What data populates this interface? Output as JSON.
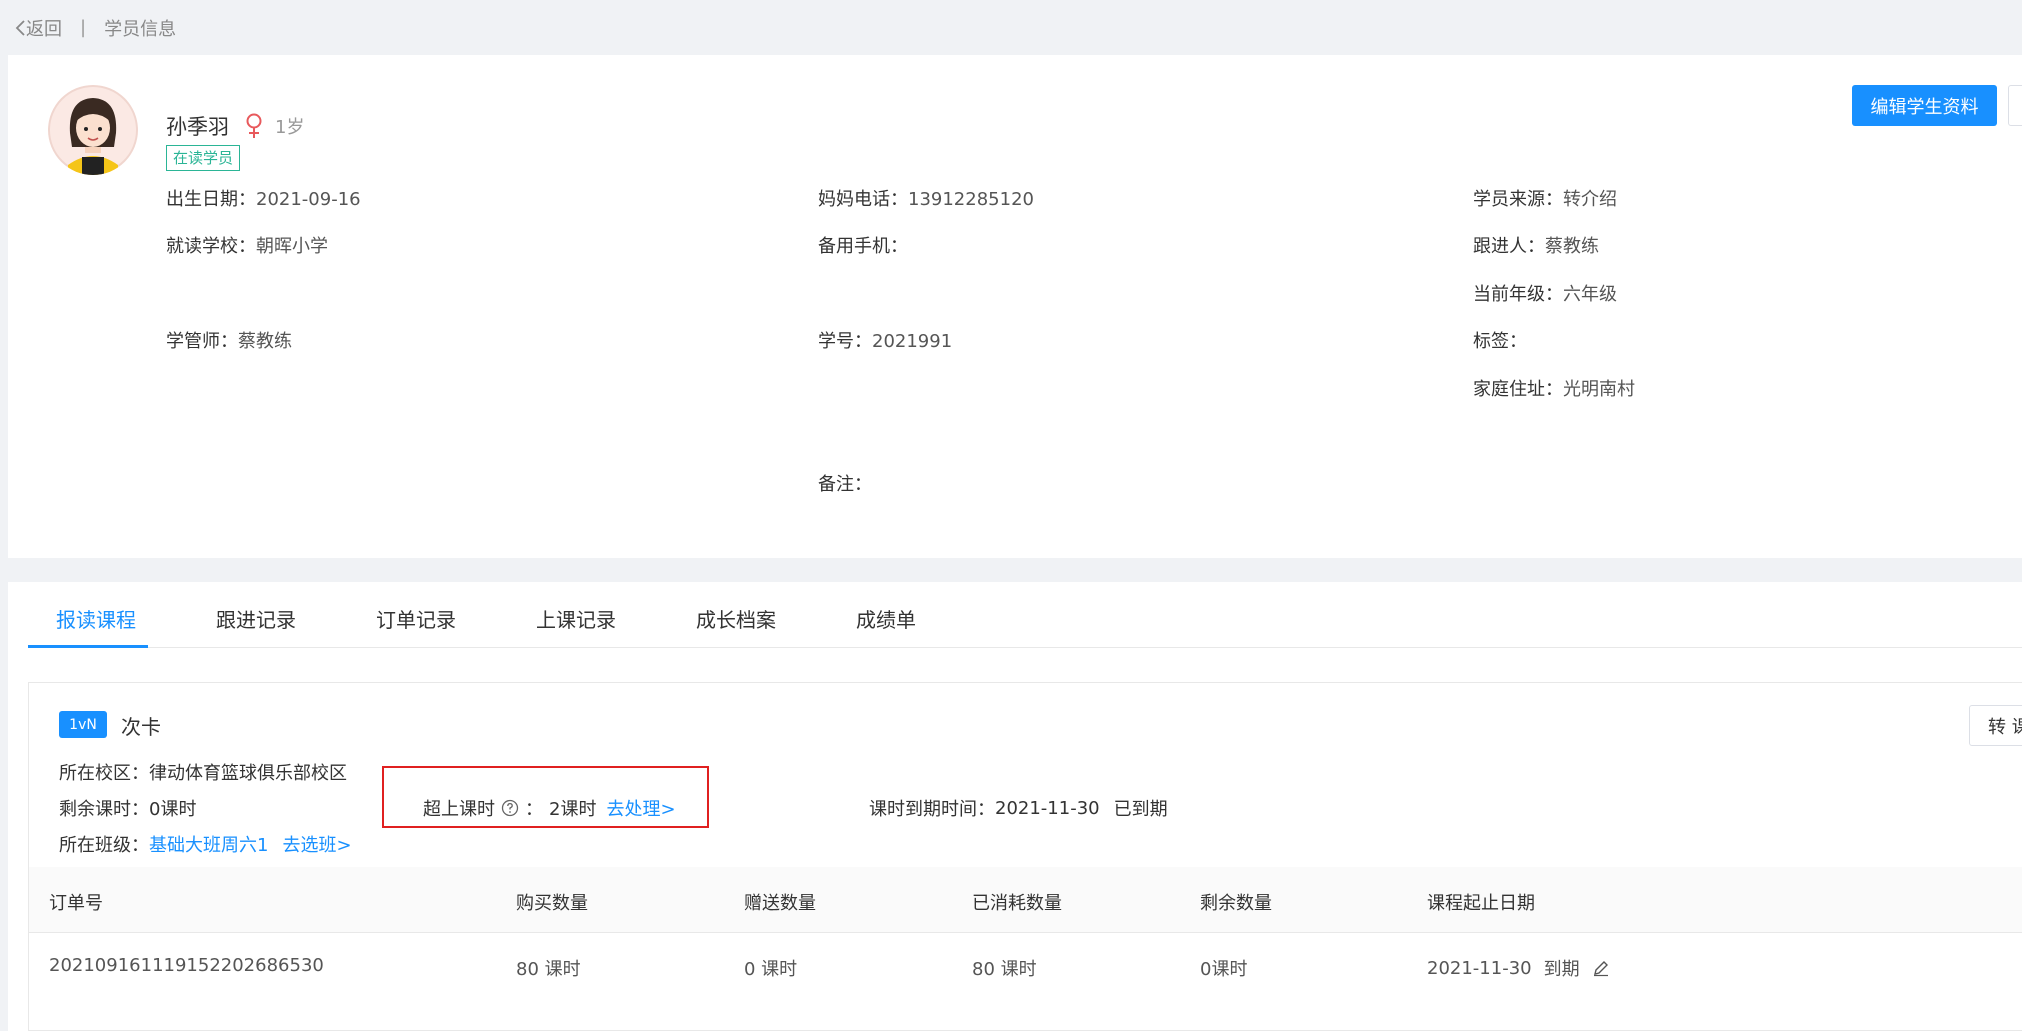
{
  "topbar": {
    "back_label": "返回",
    "separator": "|",
    "page_title": "学员信息"
  },
  "student": {
    "name": "孙季羽",
    "gender_symbol": "♀",
    "age": "1岁",
    "status": "在读学员",
    "edit_label": "编辑学生资料",
    "fields": {
      "birth_label": "出生日期：",
      "birth": "2021-09-16",
      "school_label": "就读学校：",
      "school": "朝晖小学",
      "manager_label": "学管师：",
      "manager": "蔡教练",
      "mom_phone_label": "妈妈电话：",
      "mom_phone": "13912285120",
      "backup_phone_label": "备用手机：",
      "backup_phone": "",
      "student_no_label": "学号：",
      "student_no": "2021991",
      "remark_label": "备注：",
      "remark": "",
      "source_label": "学员来源：",
      "source": "转介绍",
      "follower_label": "跟进人：",
      "follower": "蔡教练",
      "grade_label": "当前年级：",
      "grade": "六年级",
      "tag_label": "标签：",
      "tag": "",
      "address_label": "家庭住址：",
      "address": "光明南村"
    }
  },
  "tabs": [
    "报读课程",
    "跟进记录",
    "订单记录",
    "上课记录",
    "成长档案",
    "成绩单"
  ],
  "course": {
    "badge": "1vN",
    "type": "次卡",
    "campus_label": "所在校区：",
    "campus": "律动体育篮球俱乐部校区",
    "remaining_label": "剩余课时：",
    "remaining": "0课时",
    "class_label": "所在班级：",
    "class_name": "基础大班周六1",
    "select_class": "去选班>",
    "over_label": "超上课时",
    "over_sep": "：",
    "over_value": "2课时",
    "over_action": "去处理>",
    "expire_label": "课时到期时间：",
    "expire_date": "2021-11-30",
    "expire_status": "已到期",
    "transfer_label": "转 课"
  },
  "table": {
    "headers": [
      "订单号",
      "购买数量",
      "赠送数量",
      "已消耗数量",
      "剩余数量",
      "课程起止日期"
    ],
    "rows": [
      {
        "order_no": "20210916111915220268653​0",
        "purchased": "80 课时",
        "gifted": "0 课时",
        "consumed": "80 课时",
        "remaining": "0课时",
        "date": "2021-11-30",
        "date_status": "到期"
      }
    ]
  },
  "colors": {
    "accent": "#1890ff",
    "status": "#2bb596",
    "highlight": "#e02020",
    "gender": "#e8595c"
  }
}
